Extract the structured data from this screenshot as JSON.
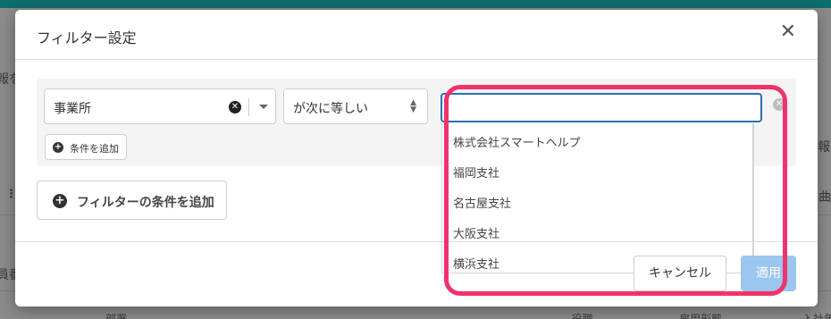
{
  "background": {
    "left_fragment": "報を",
    "right_fragment": "報",
    "list_icon": "⋮⋮",
    "right_icon": "曲",
    "left_bottom_fragment": "員番",
    "bottom_fragments": [
      "部署",
      "役職",
      "雇用形態",
      "入社年"
    ]
  },
  "modal": {
    "title": "フィルター設定",
    "close_icon": "✕"
  },
  "filter": {
    "field_value": "事業所",
    "operator_value": "が次に等しい",
    "value_input": "",
    "add_condition_label": "条件を追加",
    "add_filter_condition_label": "フィルターの条件を追加"
  },
  "dropdown": {
    "options": [
      "株式会社スマートヘルプ",
      "福岡支社",
      "名古屋支社",
      "大阪支社",
      "横浜支社"
    ]
  },
  "footer": {
    "cancel_label": "キャンセル",
    "apply_label": "適用"
  },
  "colors": {
    "highlight": "#f0336c",
    "input_focus": "#2e6db4",
    "apply_disabled": "#9bc6ee",
    "topbar": "#0d6e6e"
  }
}
